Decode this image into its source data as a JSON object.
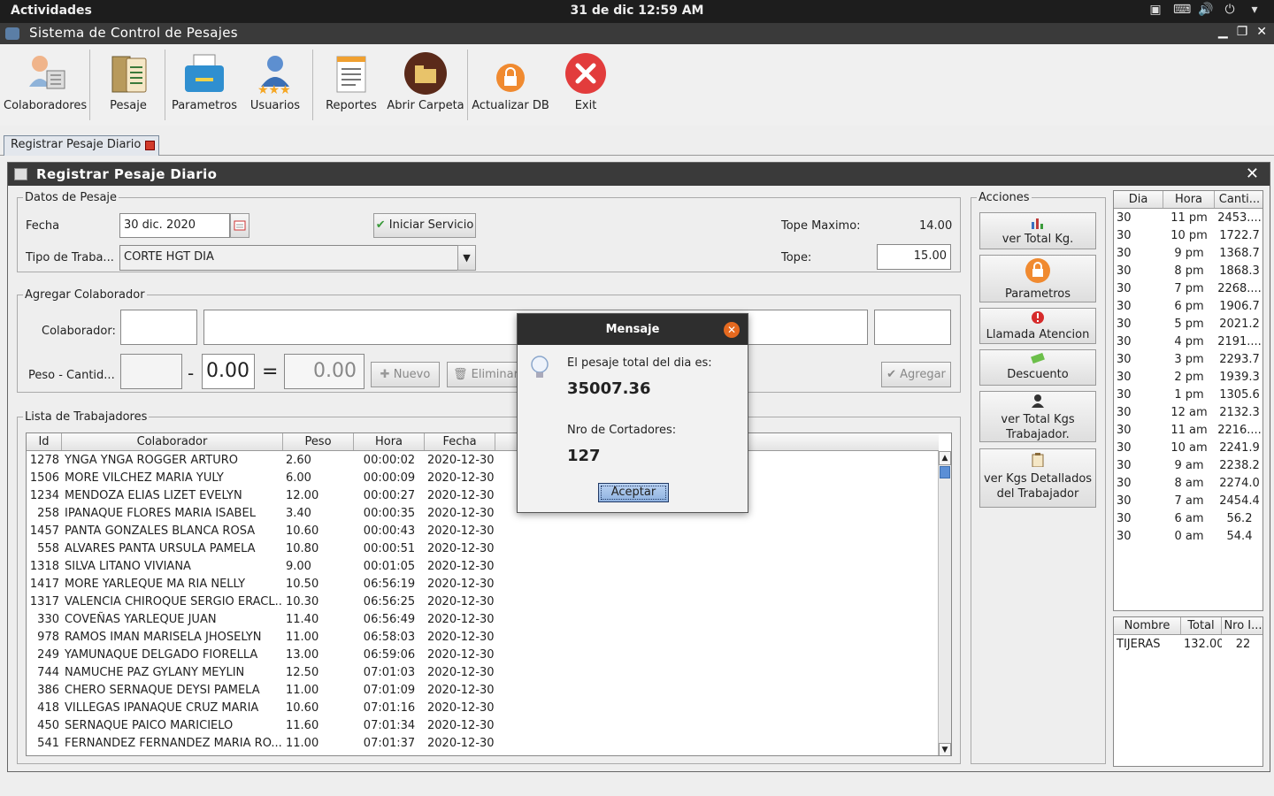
{
  "topbar": {
    "activities": "Actividades",
    "clock": "31 de dic  12:59 AM"
  },
  "window": {
    "title": "Sistema de Control de Pesajes"
  },
  "toolbar": {
    "colaboradores": "Colaboradores",
    "pesaje": "Pesaje",
    "parametros": "Parametros",
    "usuarios": "Usuarios",
    "reportes": "Reportes",
    "abrir_carpeta": "Abrir Carpeta",
    "actualizar_db": "Actualizar DB",
    "exit": "Exit"
  },
  "tab": {
    "label": "Registrar Pesaje Diario"
  },
  "frame": {
    "title": "Registrar Pesaje Diario"
  },
  "datos": {
    "legend": "Datos de Pesaje",
    "fecha_label": "Fecha",
    "fecha_value": "30 dic. 2020",
    "iniciar_label": "Iniciar Servicio",
    "tipo_label": "Tipo de Traba...",
    "tipo_value": "CORTE HGT DIA",
    "tope_max_label": "Tope Maximo:",
    "tope_max_value": "14.00",
    "tope_label": "Tope:",
    "tope_value": "15.00"
  },
  "agregar": {
    "legend": "Agregar Colaborador",
    "colaborador_label": "Colaborador:",
    "peso_label": "Peso - Cantid...",
    "minus": "-",
    "peso_input": "0.00",
    "equals": "=",
    "peso_result": "0.00",
    "nuevo_label": "Nuevo",
    "eliminar_label": "Eliminar",
    "agregar_label": "Agregar"
  },
  "lista": {
    "legend": "Lista de Trabajadores",
    "columns": [
      "Id",
      "Colaborador",
      "Peso",
      "Hora",
      "Fecha"
    ],
    "rows": [
      [
        "1278",
        "YNGA YNGA ROGGER ARTURO",
        "2.60",
        "00:00:02",
        "2020-12-30"
      ],
      [
        "1506",
        "MORE VILCHEZ MARIA YULY",
        "6.00",
        "00:00:09",
        "2020-12-30"
      ],
      [
        "1234",
        "MENDOZA ELIAS LIZET EVELYN",
        "12.00",
        "00:00:27",
        "2020-12-30"
      ],
      [
        "258",
        "IPANAQUE FLORES MARIA ISABEL",
        "3.40",
        "00:00:35",
        "2020-12-30"
      ],
      [
        "1457",
        "PANTA GONZALES BLANCA ROSA",
        "10.60",
        "00:00:43",
        "2020-12-30"
      ],
      [
        "558",
        "ALVARES PANTA URSULA PAMELA",
        "10.80",
        "00:00:51",
        "2020-12-30"
      ],
      [
        "1318",
        "SILVA LITANO VIVIANA",
        "9.00",
        "00:01:05",
        "2020-12-30"
      ],
      [
        "1417",
        "MORE YARLEQUE MA RIA NELLY",
        "10.50",
        "06:56:19",
        "2020-12-30"
      ],
      [
        "1317",
        "VALENCIA CHIROQUE SERGIO ERACL...",
        "10.30",
        "06:56:25",
        "2020-12-30"
      ],
      [
        "330",
        "COVEÑAS YARLEQUE JUAN",
        "11.40",
        "06:56:49",
        "2020-12-30"
      ],
      [
        "978",
        "RAMOS IMAN MARISELA JHOSELYN",
        "11.00",
        "06:58:03",
        "2020-12-30"
      ],
      [
        "249",
        "YAMUNAQUE DELGADO FIORELLA",
        "13.00",
        "06:59:06",
        "2020-12-30"
      ],
      [
        "744",
        "NAMUCHE PAZ GYLANY MEYLIN",
        "12.50",
        "07:01:03",
        "2020-12-30"
      ],
      [
        "386",
        "CHERO SERNAQUE DEYSI PAMELA",
        "11.00",
        "07:01:09",
        "2020-12-30"
      ],
      [
        "418",
        "VILLEGAS IPANAQUE CRUZ MARIA",
        "10.60",
        "07:01:16",
        "2020-12-30"
      ],
      [
        "450",
        "SERNAQUE PAICO MARICIELO",
        "11.60",
        "07:01:34",
        "2020-12-30"
      ],
      [
        "541",
        "FERNANDEZ FERNANDEZ MARIA RO...",
        "11.00",
        "07:01:37",
        "2020-12-30"
      ]
    ]
  },
  "acciones": {
    "legend": "Acciones",
    "ver_total_kg": "ver Total Kg.",
    "parametros": "Parametros",
    "llamada": "Llamada Atencion",
    "descuento": "Descuento",
    "ver_total_kgs_1": "ver Total Kgs",
    "ver_total_kgs_2": "Trabajador.",
    "ver_detalle_1": "ver Kgs Detallados",
    "ver_detalle_2": "del Trabajador"
  },
  "horas": {
    "columns": [
      "Dia",
      "Hora",
      "Canti..."
    ],
    "rows": [
      [
        "30",
        "11 pm",
        "2453...."
      ],
      [
        "30",
        "10 pm",
        "1722.7"
      ],
      [
        "30",
        "9 pm",
        "1368.7"
      ],
      [
        "30",
        "8 pm",
        "1868.3"
      ],
      [
        "30",
        "7 pm",
        "2268...."
      ],
      [
        "30",
        "6 pm",
        "1906.7"
      ],
      [
        "30",
        "5 pm",
        "2021.2"
      ],
      [
        "30",
        "4 pm",
        "2191...."
      ],
      [
        "30",
        "3 pm",
        "2293.7"
      ],
      [
        "30",
        "2 pm",
        "1939.3"
      ],
      [
        "30",
        "1 pm",
        "1305.6"
      ],
      [
        "30",
        "12 am",
        "2132.3"
      ],
      [
        "30",
        "11 am",
        "2216...."
      ],
      [
        "30",
        "10 am",
        "2241.9"
      ],
      [
        "30",
        "9 am",
        "2238.2"
      ],
      [
        "30",
        "8 am",
        "2274.0"
      ],
      [
        "30",
        "7 am",
        "2454.4"
      ],
      [
        "30",
        "6 am",
        "56.2"
      ],
      [
        "30",
        "0 am",
        "54.4"
      ]
    ]
  },
  "herramientas": {
    "columns": [
      "Nombre",
      "Total",
      "Nro I..."
    ],
    "rows": [
      [
        "TIJERAS",
        "132.00",
        "22"
      ]
    ]
  },
  "dialog": {
    "title": "Mensaje",
    "line1": "El pesaje total del dia es:",
    "total": "35007.36",
    "line2": "Nro de Cortadores:",
    "cortadores": "127",
    "ok": "Aceptar"
  },
  "colors": {
    "titlebar": "#3a3a3a",
    "accent_orange": "#e5691f",
    "exit_red": "#e23c3c"
  }
}
